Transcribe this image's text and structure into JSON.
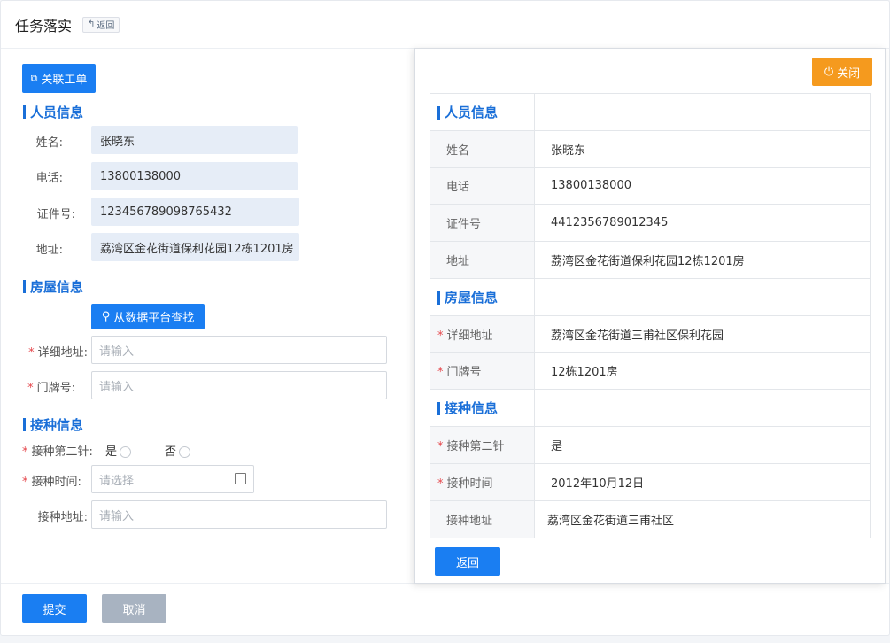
{
  "header": {
    "title": "任务落实",
    "back_tag": "返回"
  },
  "form": {
    "link_ticket_label": "关联工单",
    "person_section": "人员信息",
    "name_label": "姓名:",
    "name_value": "张晓东",
    "phone_label": "电话:",
    "phone_value": "13800138000",
    "id_label": "证件号:",
    "id_value": "123456789098765432",
    "address_label": "地址:",
    "address_value": "荔湾区金花街道保利花园12栋1201房",
    "house_section": "房屋信息",
    "search_platform_label": "从数据平台查找",
    "detail_address_label": "详细地址:",
    "detail_address_placeholder": "请输入",
    "door_label": "门牌号:",
    "door_placeholder": "请输入",
    "vaccine_section": "接种信息",
    "second_dose_label": "接种第二针:",
    "second_dose_yes": "是",
    "second_dose_no": "否",
    "vaccine_time_label": "接种时间:",
    "vaccine_time_placeholder": "请选择",
    "vaccine_place_label": "接种地址:",
    "vaccine_place_placeholder": "请输入",
    "required_mark": "*"
  },
  "footer": {
    "submit_label": "提交",
    "cancel_label": "取消"
  },
  "panel": {
    "close_label": "关闭",
    "person_section": "人员信息",
    "name_key": "姓名",
    "name_value": "张晓东",
    "phone_key": "电话",
    "phone_value": "13800138000",
    "id_key": "证件号",
    "id_value": "4412356789012345",
    "address_key": "地址",
    "address_value": "荔湾区金花街道保利花园12栋1201房",
    "house_section": "房屋信息",
    "detail_address_key": "详细地址",
    "detail_address_value": "荔湾区金花街道三甫社区保利花园",
    "door_key": "门牌号",
    "door_value": "12栋1201房",
    "vaccine_section": "接种信息",
    "second_dose_key": "接种第二针",
    "second_dose_value": "是",
    "vaccine_time_key": "接种时间",
    "vaccine_time_value": "2012年10月12日",
    "vaccine_place_key": "接种地址",
    "vaccine_place_value": "荔湾区金花街道三甫社区",
    "back_label": "返回"
  },
  "colors": {
    "primary": "#1a7ef2",
    "section": "#1a6fd8",
    "orange": "#f59a1e",
    "required": "#e5484d"
  }
}
